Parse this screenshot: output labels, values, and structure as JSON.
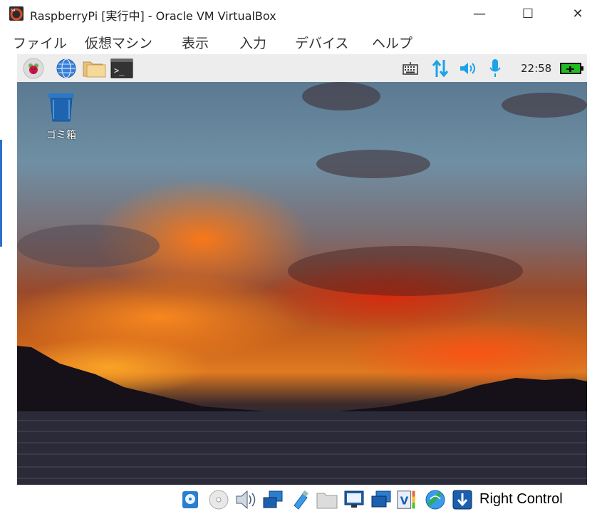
{
  "window": {
    "title": "RaspberryPi [実行中] - Oracle VM VirtualBox",
    "minimize_glyph": "—",
    "maximize_glyph": "☐",
    "close_glyph": "✕"
  },
  "menu": {
    "items": [
      "ファイル",
      "仮想マシン",
      "表示",
      "入力",
      "デバイス",
      "ヘルプ"
    ]
  },
  "guest_panel": {
    "left_icons": [
      "raspberry-menu-icon",
      "web-browser-icon",
      "file-manager-icon",
      "terminal-icon"
    ],
    "tray_icons": [
      "keyboard-icon",
      "network-arrows-icon",
      "volume-icon",
      "microphone-icon",
      "battery-charging-icon"
    ],
    "clock": "22:58",
    "terminal_glyph": ">_"
  },
  "desktop": {
    "trash_label": "ゴミ箱"
  },
  "statusbar": {
    "icons": [
      "hard-disk-icon",
      "optical-disk-icon",
      "audio-icon",
      "network-icon",
      "usb-icon",
      "shared-folders-icon",
      "display-icon",
      "recording-icon",
      "virtualization-icon",
      "mouse-integration-icon",
      "host-key-arrow-icon"
    ],
    "host_key_label": "Right Control"
  },
  "colors": {
    "accent": "#2a6fd0",
    "panel_bg": "#ededed",
    "tray_blue": "#1aa3e8",
    "battery_green": "#22bb22"
  }
}
